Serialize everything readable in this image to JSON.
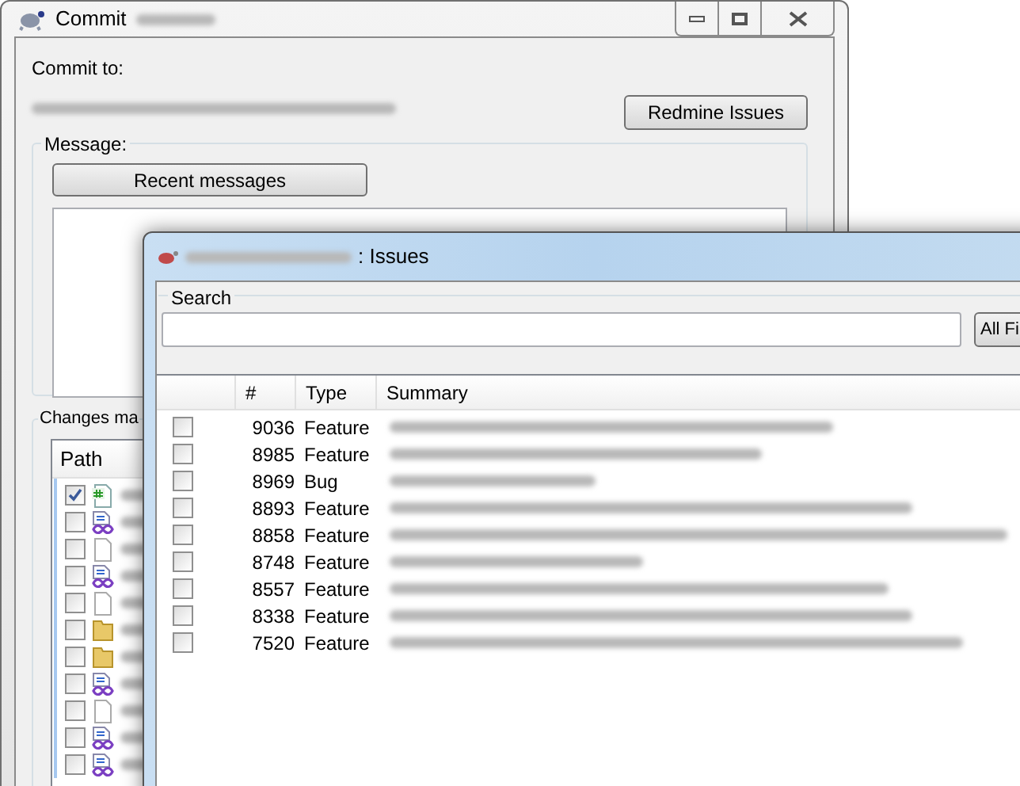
{
  "commit_window": {
    "title": "Commit",
    "commit_to_label": "Commit to:",
    "redmine_button": "Redmine Issues",
    "message_group": "Message:",
    "recent_messages_button": "Recent messages",
    "changes_group": "Changes ma",
    "path_header": "Path",
    "files": [
      {
        "kind": "csharp",
        "checked": true
      },
      {
        "kind": "project",
        "checked": false
      },
      {
        "kind": "file",
        "checked": false
      },
      {
        "kind": "project",
        "checked": false
      },
      {
        "kind": "file",
        "checked": false
      },
      {
        "kind": "folder",
        "checked": false
      },
      {
        "kind": "folder",
        "checked": false
      },
      {
        "kind": "project",
        "checked": false
      },
      {
        "kind": "file",
        "checked": false
      },
      {
        "kind": "project",
        "checked": false
      },
      {
        "kind": "project",
        "checked": false
      }
    ]
  },
  "issues_window": {
    "title_suffix": ": Issues",
    "search_group": "Search",
    "fields_button": "All Fi",
    "columns": [
      "#",
      "Type",
      "Summary"
    ],
    "rows": [
      {
        "number": "9036",
        "type": "Feature",
        "checked": false
      },
      {
        "number": "8985",
        "type": "Feature",
        "checked": false
      },
      {
        "number": "8969",
        "type": "Bug",
        "checked": false
      },
      {
        "number": "8893",
        "type": "Feature",
        "checked": false
      },
      {
        "number": "8858",
        "type": "Feature",
        "checked": false
      },
      {
        "number": "8748",
        "type": "Feature",
        "checked": false
      },
      {
        "number": "8557",
        "type": "Feature",
        "checked": false
      },
      {
        "number": "8338",
        "type": "Feature",
        "checked": false
      },
      {
        "number": "7520",
        "type": "Feature",
        "checked": false
      }
    ]
  }
}
